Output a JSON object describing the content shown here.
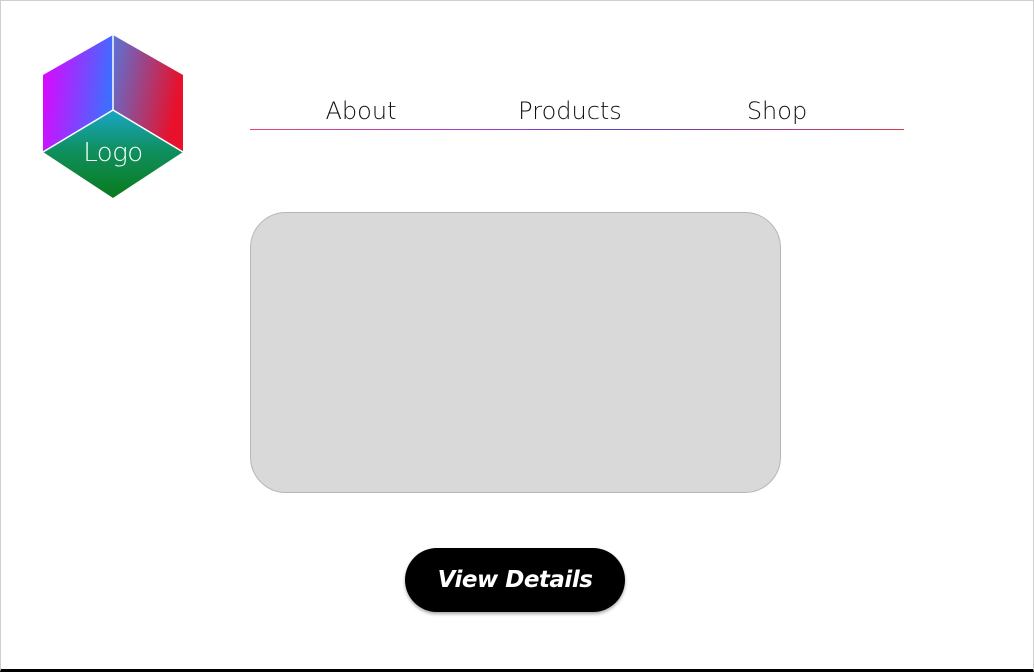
{
  "logo": {
    "label": "Logo",
    "icon": "hexagon-cube-logo",
    "colors": {
      "left_face": [
        "#e600ff",
        "#3f6dff"
      ],
      "right_face": [
        "#5a73d8",
        "#e8102a"
      ],
      "bottom_face": [
        "#1aa6c8",
        "#0a7a1c"
      ],
      "edges": "#ffffff"
    }
  },
  "nav": {
    "items": [
      {
        "label": "About"
      },
      {
        "label": "Products"
      },
      {
        "label": "Shop"
      }
    ],
    "underline_colors": [
      "#e8456a",
      "#b23bd0",
      "#5a3fc8",
      "#d83a4a"
    ]
  },
  "media": {
    "placeholder_color": "#d9d9d9"
  },
  "cta": {
    "label": "View Details",
    "background": "#000000",
    "text_color": "#ffffff"
  }
}
